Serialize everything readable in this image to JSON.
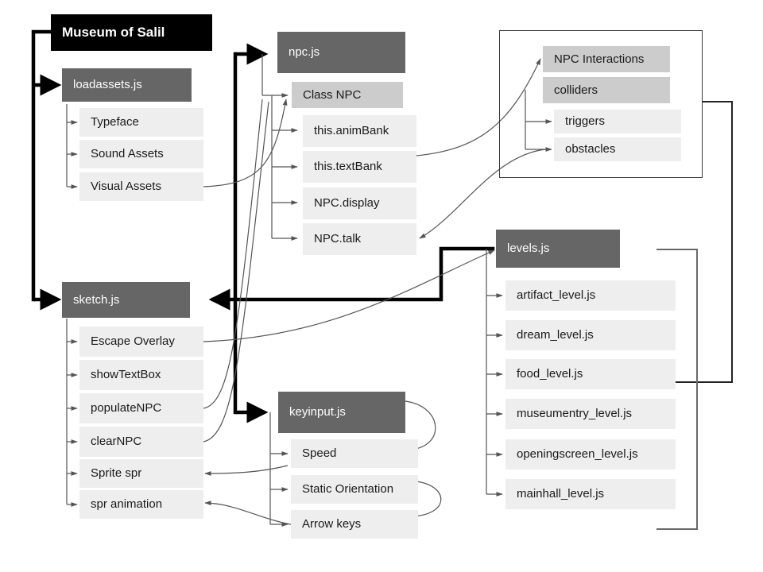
{
  "diagram": {
    "title": "Museum of Salil",
    "root": {
      "label": "Museum of Salil"
    },
    "modules": {
      "loadassets": {
        "label": "loadassets.js",
        "children": [
          {
            "label": "Typeface"
          },
          {
            "label": "Sound Assets"
          },
          {
            "label": "Visual Assets"
          }
        ]
      },
      "npc": {
        "label": "npc.js",
        "class_label": "Class NPC",
        "children": [
          {
            "label": "this.animBank"
          },
          {
            "label": "this.textBank"
          },
          {
            "label": "NPC.display"
          },
          {
            "label": "NPC.talk"
          }
        ]
      },
      "interactions": {
        "group_label": "NPC Interactions",
        "colliders_label": "colliders",
        "children": [
          {
            "label": "triggers"
          },
          {
            "label": "obstacles"
          }
        ]
      },
      "sketch": {
        "label": "sketch.js",
        "children": [
          {
            "label": "Escape Overlay"
          },
          {
            "label": "showTextBox"
          },
          {
            "label": "populateNPC"
          },
          {
            "label": "clearNPC"
          },
          {
            "label": "Sprite spr"
          },
          {
            "label": "spr animation"
          }
        ]
      },
      "keyinput": {
        "label": "keyinput.js",
        "children": [
          {
            "label": "Speed"
          },
          {
            "label": "Static Orientation"
          },
          {
            "label": "Arrow keys"
          }
        ]
      },
      "levels": {
        "label": "levels.js",
        "children": [
          {
            "label": "artifact_level.js"
          },
          {
            "label": "dream_level.js"
          },
          {
            "label": "food_level.js"
          },
          {
            "label": "museumentry_level.js"
          },
          {
            "label": "openingscreen_level.js"
          },
          {
            "label": "mainhall_level.js"
          }
        ]
      }
    },
    "colors": {
      "root_bg": "#000000",
      "module_bg": "#666666",
      "submodule_bg": "#cccccc",
      "leaf_bg": "#eeeeee",
      "text_dark": "#1a1a1a",
      "text_light": "#ffffff",
      "wire_thin": "#555555",
      "wire_thick": "#000000",
      "group_border": "#3a3a3a"
    }
  }
}
